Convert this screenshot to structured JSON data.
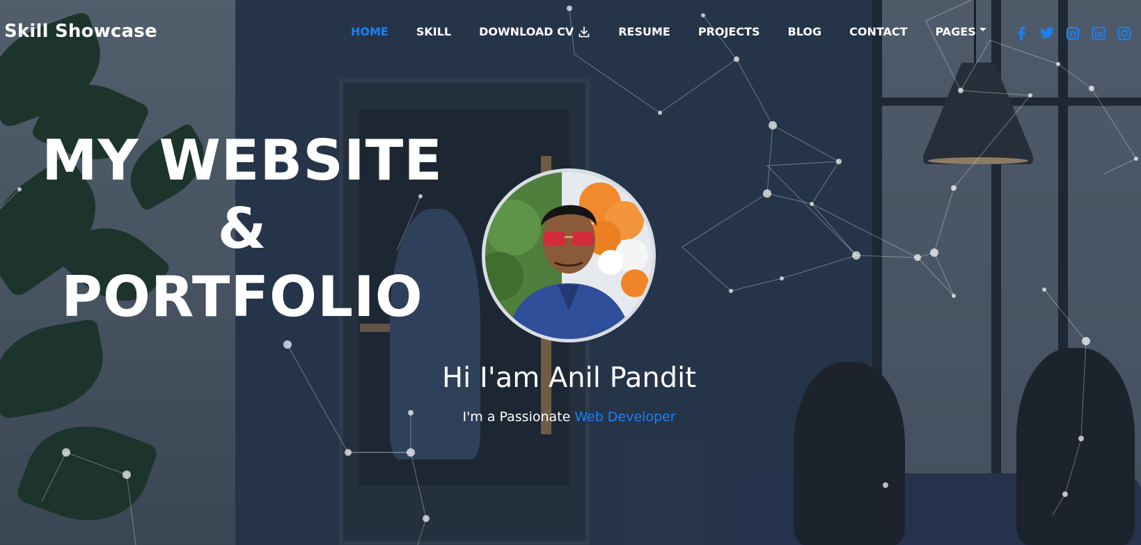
{
  "brand": {
    "name": "Skill Showcase"
  },
  "nav": {
    "home": "HOME",
    "skill": "SKILL",
    "download_cv": "DOWNLOAD CV",
    "resume": "RESUME",
    "projects": "PROJECTS",
    "blog": "BLOG",
    "contact": "CONTACT",
    "pages": "PAGES"
  },
  "socials": [
    "facebook-icon",
    "twitter-icon",
    "github-icon",
    "linkedin-icon",
    "instagram-icon"
  ],
  "hero": {
    "title_line1": "MY WEBSITE",
    "title_line2": "&",
    "title_line3": "PORTFOLIO",
    "greeting": "Hi I'am Anil Pandit",
    "tagline_prefix": "I'm a Passionate ",
    "tagline_role": "Web Developer"
  },
  "colors": {
    "accent": "#1a82f7",
    "text": "#ffffff"
  }
}
